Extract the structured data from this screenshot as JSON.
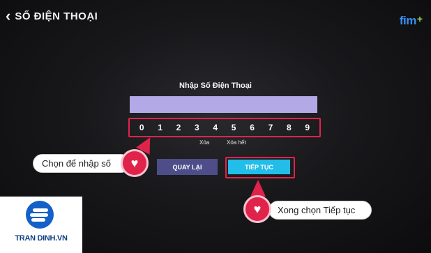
{
  "header": {
    "back_icon": "chevron-left-icon",
    "title": "SỐ ĐIỆN THOẠI"
  },
  "logo": {
    "text": "fim",
    "plus": "+"
  },
  "form": {
    "label": "Nhập Số Điện Thoại",
    "phone_value": "",
    "keys": [
      "0",
      "1",
      "2",
      "3",
      "4",
      "5",
      "6",
      "7",
      "8",
      "9"
    ],
    "delete_label": "Xóa",
    "delete_all_label": "Xóa hết",
    "back_button": "QUAY LẠI",
    "next_button": "TIẾP TỤC"
  },
  "annotations": {
    "callout_1": "Chọn để nhập số",
    "callout_2": "Xong chọn Tiếp tục",
    "icon": "heart-icon"
  },
  "brand": {
    "text": "TRAN DINH.VN"
  },
  "colors": {
    "highlight": "#e0234b",
    "input_bg": "#b2a9e6",
    "next_button": "#22bde8",
    "back_button": "#4e4d8a"
  }
}
